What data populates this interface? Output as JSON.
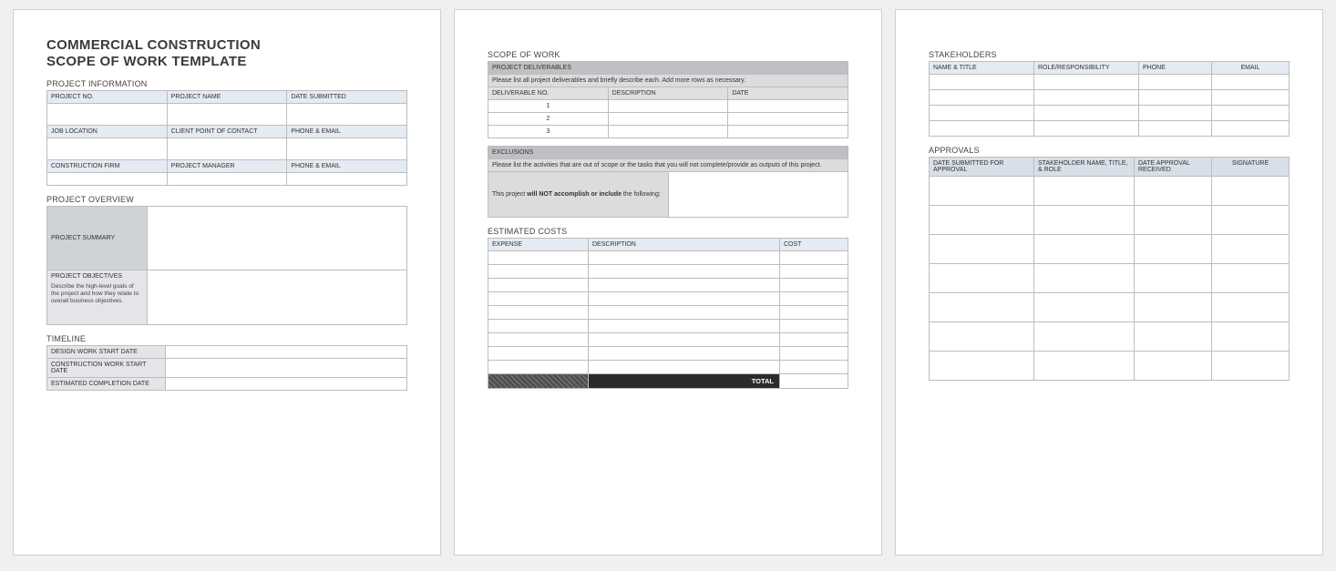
{
  "title_line1": "COMMERCIAL CONSTRUCTION",
  "title_line2": "SCOPE OF WORK TEMPLATE",
  "sections": {
    "project_info": "PROJECT INFORMATION",
    "project_overview": "PROJECT OVERVIEW",
    "timeline": "TIMELINE",
    "scope_of_work": "SCOPE OF WORK",
    "estimated_costs": "ESTIMATED COSTS",
    "stakeholders": "STAKEHOLDERS",
    "approvals": "APPROVALS"
  },
  "proj_info": {
    "r1": {
      "a": "PROJECT NO.",
      "b": "PROJECT NAME",
      "c": "DATE SUBMITTED"
    },
    "r2": {
      "a": "JOB LOCATION",
      "b": "CLIENT POINT OF CONTACT",
      "c": "PHONE & EMAIL"
    },
    "r3": {
      "a": "CONSTRUCTION FIRM",
      "b": "PROJECT MANAGER",
      "c": "PHONE & EMAIL"
    }
  },
  "overview": {
    "summary_label": "PROJECT SUMMARY",
    "objectives_label": "PROJECT OBJECTIVES",
    "objectives_desc": "Describe the high-level goals of the project and how they relate to overall business objectives."
  },
  "timeline": {
    "r1": "DESIGN WORK START DATE",
    "r2": "CONSTRUCTION WORK START DATE",
    "r3": "ESTIMATED COMPLETION DATE"
  },
  "deliverables": {
    "bar": "PROJECT DELIVERABLES",
    "instr": "Please list all project deliverables and briefly describe each. Add more rows as necessary.",
    "col1": "DELIVERABLE NO.",
    "col2": "DESCRIPTION",
    "col3": "DATE",
    "rows": {
      "a": "1",
      "b": "2",
      "c": "3"
    }
  },
  "exclusions": {
    "bar": "EXCLUSIONS",
    "instr": "Please list the activities that are out of scope or the tasks that you will not complete/provide as outputs of this project.",
    "left1": "This project ",
    "left2": "will NOT accomplish or include",
    "left3": " the following:"
  },
  "costs": {
    "col1": "EXPENSE",
    "col2": "DESCRIPTION",
    "col3": "COST",
    "total": "TOTAL"
  },
  "stake": {
    "col1": "NAME & TITLE",
    "col2": "ROLE/RESPONSIBILITY",
    "col3": "PHONE",
    "col4": "EMAIL"
  },
  "approvals": {
    "col1": "DATE SUBMITTED FOR APPROVAL",
    "col2": "STAKEHOLDER NAME, TITLE, & ROLE",
    "col3": "DATE APPROVAL RECEIVED",
    "col4": "SIGNATURE"
  }
}
